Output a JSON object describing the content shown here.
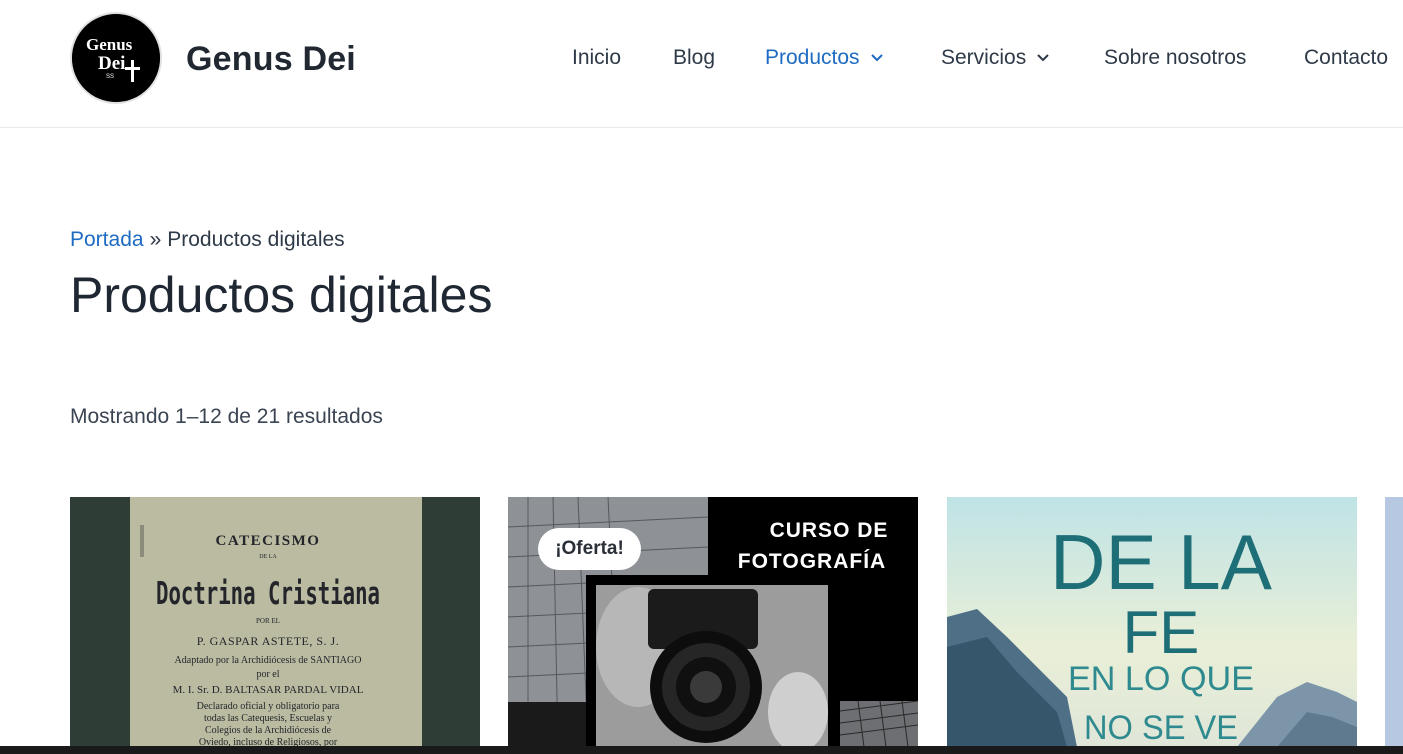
{
  "site": {
    "title": "Genus Dei",
    "logo_text": [
      "Genus",
      "Dei",
      "SS"
    ]
  },
  "nav": {
    "items": [
      {
        "label": "Inicio",
        "dropdown": false,
        "active": false
      },
      {
        "label": "Blog",
        "dropdown": false,
        "active": false
      },
      {
        "label": "Productos",
        "dropdown": true,
        "active": true
      },
      {
        "label": "Servicios",
        "dropdown": true,
        "active": false
      },
      {
        "label": "Sobre nosotros",
        "dropdown": false,
        "active": false
      },
      {
        "label": "Contacto",
        "dropdown": false,
        "active": false
      }
    ]
  },
  "breadcrumb": {
    "home": "Portada",
    "separator": "»",
    "current": "Productos digitales"
  },
  "page": {
    "title": "Productos digitales",
    "results_text": "Mostrando 1–12 de 21 resultados"
  },
  "products": [
    {
      "image_text": {
        "l1": "CATECISMO",
        "l2": "DE LA",
        "l3": "Doctrina Cristiana",
        "l4": "POR EL",
        "l5": "P. GASPAR ASTETE, S. J.",
        "l6": "Adaptado por la Archidiócesis de SANTIAGO",
        "l7": "por el",
        "l8": "M. I. Sr. D. BALTASAR PARDAL VIDAL",
        "l9": "Declarado oficial y obligatorio para",
        "l10": "todas las Catequesis, Escuelas y",
        "l11": "Colegios de la Archidiócesis de",
        "l12": "Oviedo, incluso de Religiosos, por"
      }
    },
    {
      "badge": "¡Oferta!",
      "image_text": {
        "l1": "CURSO DE",
        "l2": "FOTOGRAFÍA"
      }
    },
    {
      "image_text": {
        "l1": "DE LA",
        "l2": "FE",
        "l3": "EN LO QUE",
        "l4": "NO SE VE"
      }
    }
  ],
  "colors": {
    "accent": "#1e6bc1",
    "text": "#2f3a48",
    "heading": "#1f2733"
  }
}
